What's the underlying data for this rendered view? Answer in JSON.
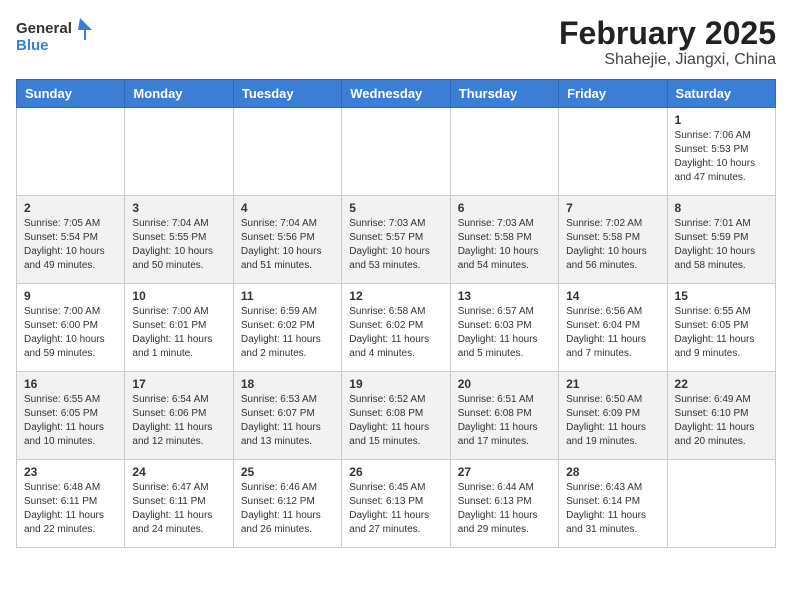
{
  "header": {
    "logo_general": "General",
    "logo_blue": "Blue",
    "month_year": "February 2025",
    "location": "Shahejie, Jiangxi, China"
  },
  "calendar": {
    "days_of_week": [
      "Sunday",
      "Monday",
      "Tuesday",
      "Wednesday",
      "Thursday",
      "Friday",
      "Saturday"
    ],
    "weeks": [
      [
        {
          "day": "",
          "info": ""
        },
        {
          "day": "",
          "info": ""
        },
        {
          "day": "",
          "info": ""
        },
        {
          "day": "",
          "info": ""
        },
        {
          "day": "",
          "info": ""
        },
        {
          "day": "",
          "info": ""
        },
        {
          "day": "1",
          "info": "Sunrise: 7:06 AM\nSunset: 5:53 PM\nDaylight: 10 hours and 47 minutes."
        }
      ],
      [
        {
          "day": "2",
          "info": "Sunrise: 7:05 AM\nSunset: 5:54 PM\nDaylight: 10 hours and 49 minutes."
        },
        {
          "day": "3",
          "info": "Sunrise: 7:04 AM\nSunset: 5:55 PM\nDaylight: 10 hours and 50 minutes."
        },
        {
          "day": "4",
          "info": "Sunrise: 7:04 AM\nSunset: 5:56 PM\nDaylight: 10 hours and 51 minutes."
        },
        {
          "day": "5",
          "info": "Sunrise: 7:03 AM\nSunset: 5:57 PM\nDaylight: 10 hours and 53 minutes."
        },
        {
          "day": "6",
          "info": "Sunrise: 7:03 AM\nSunset: 5:58 PM\nDaylight: 10 hours and 54 minutes."
        },
        {
          "day": "7",
          "info": "Sunrise: 7:02 AM\nSunset: 5:58 PM\nDaylight: 10 hours and 56 minutes."
        },
        {
          "day": "8",
          "info": "Sunrise: 7:01 AM\nSunset: 5:59 PM\nDaylight: 10 hours and 58 minutes."
        }
      ],
      [
        {
          "day": "9",
          "info": "Sunrise: 7:00 AM\nSunset: 6:00 PM\nDaylight: 10 hours and 59 minutes."
        },
        {
          "day": "10",
          "info": "Sunrise: 7:00 AM\nSunset: 6:01 PM\nDaylight: 11 hours and 1 minute."
        },
        {
          "day": "11",
          "info": "Sunrise: 6:59 AM\nSunset: 6:02 PM\nDaylight: 11 hours and 2 minutes."
        },
        {
          "day": "12",
          "info": "Sunrise: 6:58 AM\nSunset: 6:02 PM\nDaylight: 11 hours and 4 minutes."
        },
        {
          "day": "13",
          "info": "Sunrise: 6:57 AM\nSunset: 6:03 PM\nDaylight: 11 hours and 5 minutes."
        },
        {
          "day": "14",
          "info": "Sunrise: 6:56 AM\nSunset: 6:04 PM\nDaylight: 11 hours and 7 minutes."
        },
        {
          "day": "15",
          "info": "Sunrise: 6:55 AM\nSunset: 6:05 PM\nDaylight: 11 hours and 9 minutes."
        }
      ],
      [
        {
          "day": "16",
          "info": "Sunrise: 6:55 AM\nSunset: 6:05 PM\nDaylight: 11 hours and 10 minutes."
        },
        {
          "day": "17",
          "info": "Sunrise: 6:54 AM\nSunset: 6:06 PM\nDaylight: 11 hours and 12 minutes."
        },
        {
          "day": "18",
          "info": "Sunrise: 6:53 AM\nSunset: 6:07 PM\nDaylight: 11 hours and 13 minutes."
        },
        {
          "day": "19",
          "info": "Sunrise: 6:52 AM\nSunset: 6:08 PM\nDaylight: 11 hours and 15 minutes."
        },
        {
          "day": "20",
          "info": "Sunrise: 6:51 AM\nSunset: 6:08 PM\nDaylight: 11 hours and 17 minutes."
        },
        {
          "day": "21",
          "info": "Sunrise: 6:50 AM\nSunset: 6:09 PM\nDaylight: 11 hours and 19 minutes."
        },
        {
          "day": "22",
          "info": "Sunrise: 6:49 AM\nSunset: 6:10 PM\nDaylight: 11 hours and 20 minutes."
        }
      ],
      [
        {
          "day": "23",
          "info": "Sunrise: 6:48 AM\nSunset: 6:11 PM\nDaylight: 11 hours and 22 minutes."
        },
        {
          "day": "24",
          "info": "Sunrise: 6:47 AM\nSunset: 6:11 PM\nDaylight: 11 hours and 24 minutes."
        },
        {
          "day": "25",
          "info": "Sunrise: 6:46 AM\nSunset: 6:12 PM\nDaylight: 11 hours and 26 minutes."
        },
        {
          "day": "26",
          "info": "Sunrise: 6:45 AM\nSunset: 6:13 PM\nDaylight: 11 hours and 27 minutes."
        },
        {
          "day": "27",
          "info": "Sunrise: 6:44 AM\nSunset: 6:13 PM\nDaylight: 11 hours and 29 minutes."
        },
        {
          "day": "28",
          "info": "Sunrise: 6:43 AM\nSunset: 6:14 PM\nDaylight: 11 hours and 31 minutes."
        },
        {
          "day": "",
          "info": ""
        }
      ]
    ]
  }
}
